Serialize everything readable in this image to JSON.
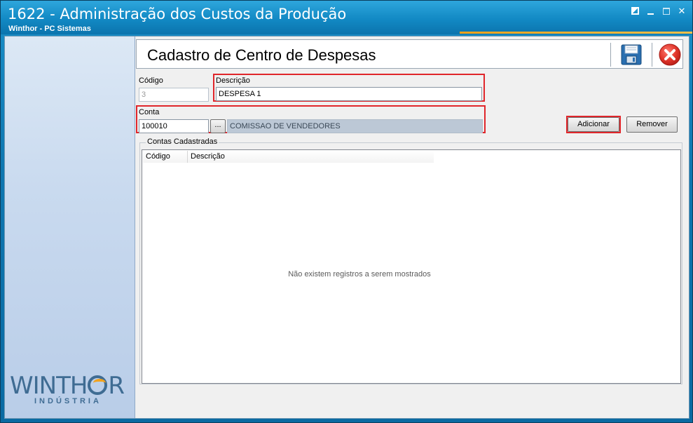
{
  "window": {
    "title": "1622 - Administração dos Custos da Produção",
    "subtitle": "Winthor - PC Sistemas"
  },
  "window_controls": [
    "restore-icon",
    "minimize-icon",
    "maximize-icon",
    "close-icon"
  ],
  "logo": {
    "text_before": "WINTH",
    "text_after": "R",
    "sub": "INDÚSTRIA"
  },
  "header": {
    "title": "Cadastro de Centro de Despesas",
    "save_icon": "floppy-disk-icon",
    "close_icon": "red-x-circle-icon"
  },
  "form": {
    "codigo_label": "Código",
    "codigo_value": "3",
    "descricao_label": "Descrição",
    "descricao_value": "DESPESA 1",
    "conta_label": "Conta",
    "conta_value": "100010",
    "conta_lookup_label": "...",
    "conta_desc_value": "COMISSAO DE VENDEDORES",
    "adicionar_label": "Adicionar",
    "remover_label": "Remover"
  },
  "contas": {
    "group_title": "Contas Cadastradas",
    "columns": [
      "Código",
      "Descrição"
    ],
    "rows": [],
    "empty_message": "Não existem registros a serem mostrados"
  },
  "colors": {
    "titlebar": "#1289c4",
    "accent_stripe": "#f2a21b",
    "highlight_frame": "#e0262b",
    "readonly_field": "#bcc8d6"
  }
}
